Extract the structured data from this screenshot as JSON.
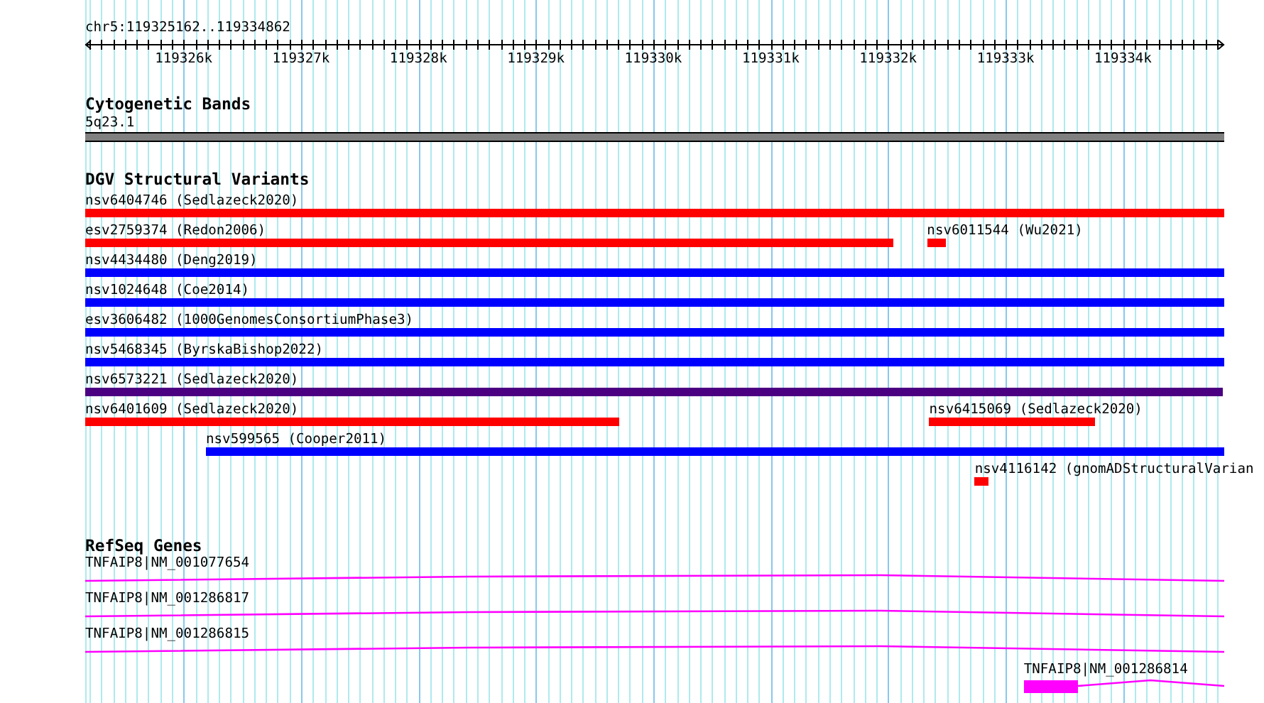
{
  "ruler": {
    "location": "chr5:119325162..119334862",
    "ticks": [
      "119326k",
      "119327k",
      "119328k",
      "119329k",
      "119330k",
      "119331k",
      "119332k",
      "119333k",
      "119334k"
    ]
  },
  "tracks": [
    {
      "kind": "cytoband",
      "title": "Cytogenetic Bands",
      "bands": [
        {
          "name": "5q23.1"
        }
      ]
    },
    {
      "kind": "variants",
      "title": "DGV Structural Variants",
      "rows": [
        {
          "features": [
            {
              "label": "nsv6404746 (Sedlazeck2020)",
              "color": "#ff0000"
            }
          ]
        },
        {
          "features": [
            {
              "label": "esv2759374 (Redon2006)",
              "color": "#ff0000"
            },
            {
              "label": "nsv6011544 (Wu2021)",
              "color": "#ff0000"
            }
          ]
        },
        {
          "features": [
            {
              "label": "nsv4434480 (Deng2019)",
              "color": "#0000ff"
            }
          ]
        },
        {
          "features": [
            {
              "label": "nsv1024648 (Coe2014)",
              "color": "#0000ff"
            }
          ]
        },
        {
          "features": [
            {
              "label": "esv3606482 (1000GenomesConsortiumPhase3)",
              "color": "#0000ff"
            }
          ]
        },
        {
          "features": [
            {
              "label": "nsv5468345 (ByrskaBishop2022)",
              "color": "#0000ff"
            }
          ]
        },
        {
          "features": [
            {
              "label": "nsv6573221 (Sedlazeck2020)",
              "color": "#4b0082"
            }
          ]
        },
        {
          "features": [
            {
              "label": "nsv6401609 (Sedlazeck2020)",
              "color": "#ff0000"
            },
            {
              "label": "nsv6415069 (Sedlazeck2020)",
              "color": "#ff0000"
            }
          ]
        },
        {
          "features": [
            {
              "label": "nsv599565 (Cooper2011)",
              "color": "#0000ff"
            }
          ]
        },
        {
          "features": [
            {
              "label": "nsv4116142 (gnomADStructuralVarian",
              "color": "#ff0000"
            }
          ]
        }
      ]
    },
    {
      "kind": "genes",
      "title": "RefSeq Genes",
      "genes": [
        {
          "name": "TNFAIP8|NM_001077654"
        },
        {
          "name": "TNFAIP8|NM_001286817"
        },
        {
          "name": "TNFAIP8|NM_001286815"
        },
        {
          "name": "TNFAIP8|NM_001286814"
        }
      ]
    }
  ]
}
